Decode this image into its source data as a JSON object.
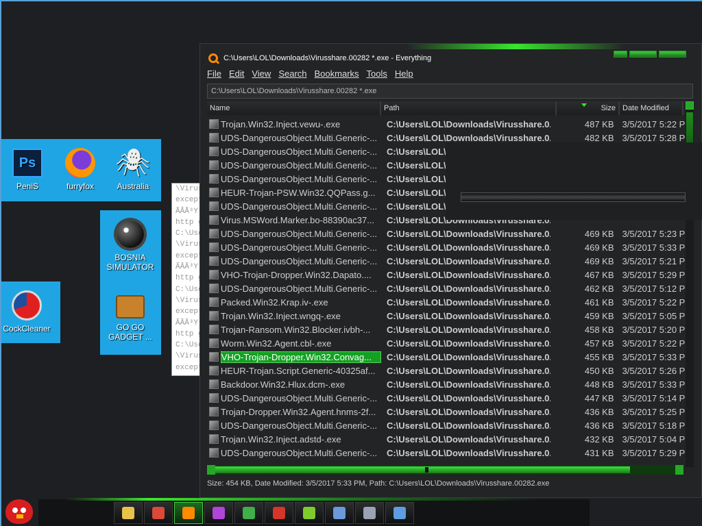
{
  "desktop": {
    "group1": [
      {
        "label": "PeniS",
        "icon": "photoshop-icon"
      },
      {
        "label": "furryfox",
        "icon": "firefox-icon"
      },
      {
        "label": "Australia",
        "icon": "spider-solitaire-icon"
      }
    ],
    "group2": [
      {
        "label": "BOSNIA SIMULATOR",
        "icon": "minesweeper-icon"
      },
      {
        "label": "GO GO GADGET ...",
        "icon": "briefcase-icon"
      }
    ],
    "group3": [
      {
        "label": "CockCleaner",
        "icon": "ccleaner-icon"
      }
    ],
    "notepad_lines": [
      "\\Virus",
      "except",
      "ÃÂÃ³Y",
      "http ge",
      "C:\\Use",
      "\\Virus",
      "except",
      "ÃÂÃ³Y",
      "http ge",
      "C:\\Use",
      "\\Virus",
      "except",
      "ÃÂÃ³Y",
      "http ge",
      "C:\\Use",
      "\\Virus",
      "except"
    ]
  },
  "window": {
    "title": "C:\\Users\\LOL\\Downloads\\Virusshare.00282 *.exe - Everything",
    "menu": [
      "File",
      "Edit",
      "View",
      "Search",
      "Bookmarks",
      "Tools",
      "Help"
    ],
    "search_value": "C:\\Users\\LOL\\Downloads\\Virusshare.00282 *.exe",
    "columns": {
      "name": "Name",
      "path": "Path",
      "size": "Size",
      "date": "Date Modified"
    },
    "rows": [
      {
        "name": "Trojan.Win32.Inject.vewu-.exe",
        "path": "C:\\Users\\LOL\\Downloads\\Virusshare.0...",
        "size": "487 KB",
        "date": "3/5/2017 5:22 PM"
      },
      {
        "name": "UDS-DangerousObject.Multi.Generic-...",
        "path": "C:\\Users\\LOL\\Downloads\\Virusshare.0...",
        "size": "482 KB",
        "date": "3/5/2017 5:28 PM"
      },
      {
        "name": "UDS-DangerousObject.Multi.Generic-...",
        "path": "C:\\Users\\LOL\\D",
        "size": "",
        "date": ""
      },
      {
        "name": "UDS-DangerousObject.Multi.Generic-...",
        "path": "C:\\Users\\LOL\\D",
        "size": "",
        "date": ""
      },
      {
        "name": "UDS-DangerousObject.Multi.Generic-...",
        "path": "C:\\Users\\LOL\\D",
        "size": "",
        "date": ""
      },
      {
        "name": "HEUR-Trojan-PSW.Win32.QQPass.g...",
        "path": "C:\\Users\\LOL\\D",
        "size": "",
        "date": ""
      },
      {
        "name": "UDS-DangerousObject.Multi.Generic-...",
        "path": "C:\\Users\\LOL\\D",
        "size": "",
        "date": ""
      },
      {
        "name": "Virus.MSWord.Marker.bo-88390ac37...",
        "path": "C:\\Users\\LOL\\Downloads\\Virusshare.0...",
        "size": "",
        "date": ""
      },
      {
        "name": "UDS-DangerousObject.Multi.Generic-...",
        "path": "C:\\Users\\LOL\\Downloads\\Virusshare.0...",
        "size": "469 KB",
        "date": "3/5/2017 5:23 PM"
      },
      {
        "name": "UDS-DangerousObject.Multi.Generic-...",
        "path": "C:\\Users\\LOL\\Downloads\\Virusshare.0...",
        "size": "469 KB",
        "date": "3/5/2017 5:33 PM"
      },
      {
        "name": "UDS-DangerousObject.Multi.Generic-...",
        "path": "C:\\Users\\LOL\\Downloads\\Virusshare.0...",
        "size": "469 KB",
        "date": "3/5/2017 5:21 PM"
      },
      {
        "name": "VHO-Trojan-Dropper.Win32.Dapato....",
        "path": "C:\\Users\\LOL\\Downloads\\Virusshare.0...",
        "size": "467 KB",
        "date": "3/5/2017 5:29 PM"
      },
      {
        "name": "UDS-DangerousObject.Multi.Generic-...",
        "path": "C:\\Users\\LOL\\Downloads\\Virusshare.0...",
        "size": "462 KB",
        "date": "3/5/2017 5:12 PM"
      },
      {
        "name": "Packed.Win32.Krap.iv-.exe",
        "path": "C:\\Users\\LOL\\Downloads\\Virusshare.0...",
        "size": "461 KB",
        "date": "3/5/2017 5:22 PM"
      },
      {
        "name": "Trojan.Win32.Inject.wngq-.exe",
        "path": "C:\\Users\\LOL\\Downloads\\Virusshare.0...",
        "size": "459 KB",
        "date": "3/5/2017 5:05 PM"
      },
      {
        "name": "Trojan-Ransom.Win32.Blocker.ivbh-...",
        "path": "C:\\Users\\LOL\\Downloads\\Virusshare.0...",
        "size": "458 KB",
        "date": "3/5/2017 5:20 PM"
      },
      {
        "name": "Worm.Win32.Agent.cbl-.exe",
        "path": "C:\\Users\\LOL\\Downloads\\Virusshare.0...",
        "size": "457 KB",
        "date": "3/5/2017 5:22 PM"
      },
      {
        "name": "VHO-Trojan-Dropper.Win32.Convag...",
        "path": "C:\\Users\\LOL\\Downloads\\Virusshare.0...",
        "size": "455 KB",
        "date": "3/5/2017 5:33 PM",
        "selected": true
      },
      {
        "name": "HEUR-Trojan.Script.Generic-40325af...",
        "path": "C:\\Users\\LOL\\Downloads\\Virusshare.0...",
        "size": "450 KB",
        "date": "3/5/2017 5:26 PM"
      },
      {
        "name": "Backdoor.Win32.Hlux.dcm-.exe",
        "path": "C:\\Users\\LOL\\Downloads\\Virusshare.0...",
        "size": "448 KB",
        "date": "3/5/2017 5:33 PM"
      },
      {
        "name": "UDS-DangerousObject.Multi.Generic-...",
        "path": "C:\\Users\\LOL\\Downloads\\Virusshare.0...",
        "size": "447 KB",
        "date": "3/5/2017 5:14 PM"
      },
      {
        "name": "Trojan-Dropper.Win32.Agent.hnms-2f...",
        "path": "C:\\Users\\LOL\\Downloads\\Virusshare.0...",
        "size": "436 KB",
        "date": "3/5/2017 5:25 PM"
      },
      {
        "name": "UDS-DangerousObject.Multi.Generic-...",
        "path": "C:\\Users\\LOL\\Downloads\\Virusshare.0...",
        "size": "436 KB",
        "date": "3/5/2017 5:18 PM"
      },
      {
        "name": "Trojan.Win32.Inject.adstd-.exe",
        "path": "C:\\Users\\LOL\\Downloads\\Virusshare.0...",
        "size": "432 KB",
        "date": "3/5/2017 5:04 PM"
      },
      {
        "name": "UDS-DangerousObject.Multi.Generic-...",
        "path": "C:\\Users\\LOL\\Downloads\\Virusshare.0...",
        "size": "431 KB",
        "date": "3/5/2017 5:29 PM"
      }
    ],
    "status": "Size: 454 KB, Date Modified: 3/5/2017 5:33 PM, Path: C:\\Users\\LOL\\Downloads\\Virusshare.00282.exe"
  },
  "taskbar": {
    "start_icon": "angry-bird-icon",
    "buttons": [
      {
        "icon": "file-explorer-icon",
        "color": "#e8c34a"
      },
      {
        "icon": "chrome-icon",
        "color": "#d94a3a"
      },
      {
        "icon": "everything-search-icon",
        "color": "#ff8a00",
        "active": true
      },
      {
        "icon": "app-s-icon",
        "color": "#b045d8"
      },
      {
        "icon": "app-badge-icon",
        "color": "#3fae4b"
      },
      {
        "icon": "app-red-icon",
        "color": "#d6352a"
      },
      {
        "icon": "app-shield-icon",
        "color": "#7ecb2b"
      },
      {
        "icon": "network-icon",
        "color": "#6a9ad9"
      },
      {
        "icon": "installer-icon",
        "color": "#9aa3b3"
      },
      {
        "icon": "remote-desktop-icon",
        "color": "#5e9ee0"
      }
    ]
  },
  "colors": {
    "accent": "#39e62e",
    "desktop_tile": "#1fa5e3",
    "background": "#1e1f22"
  }
}
